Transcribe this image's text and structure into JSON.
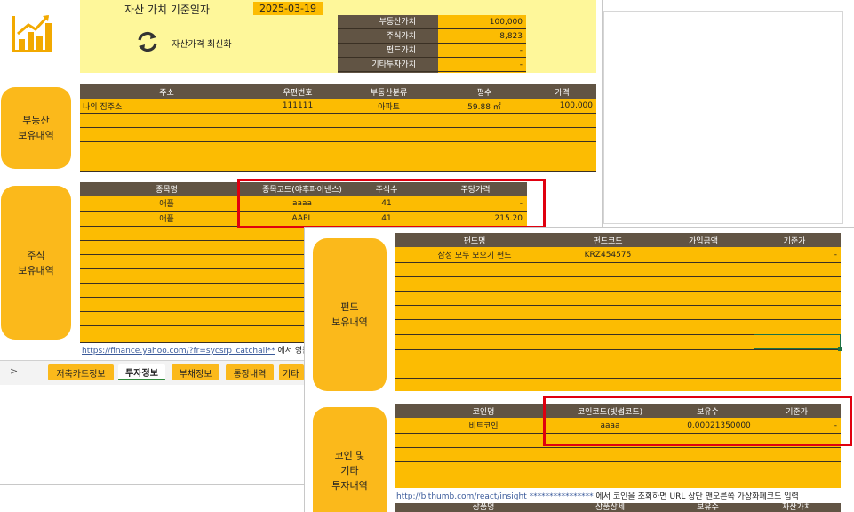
{
  "header": {
    "date_label": "자산 가치 기준일자",
    "date_value": "2025-03-19",
    "refresh_label": "자산가격 최신화",
    "summary": [
      {
        "label": "부동산가치",
        "value": "100,000"
      },
      {
        "label": "주식가치",
        "value": "8,823"
      },
      {
        "label": "펀드가치",
        "value": "-"
      },
      {
        "label": "기타투자가치",
        "value": "-"
      }
    ]
  },
  "real_estate": {
    "section_label": "부동산\n보유내역",
    "columns": [
      "주소",
      "우편번호",
      "부동산분류",
      "평수",
      "가격"
    ],
    "rows": [
      {
        "address": "나의 집주소",
        "zip": "111111",
        "type": "아파트",
        "area": "59.88  ㎡",
        "price": "100,000"
      }
    ]
  },
  "stocks": {
    "section_label": "주식\n보유내역",
    "columns": [
      "종목명",
      "종목코드(야후파이낸스)",
      "주식수",
      "주당가격"
    ],
    "rows": [
      {
        "name": "애플",
        "code": "aaaa",
        "shares": "41",
        "price": "-"
      },
      {
        "name": "애플",
        "code": "AAPL",
        "shares": "41",
        "price": "215.20"
      }
    ],
    "link": "https://finance.yahoo.com/?fr=sycsrp_catchall**",
    "link_note": " 에서 영문으로"
  },
  "sheet_tabs": {
    "arrow": ">",
    "tabs": [
      "저축카드정보",
      "투자정보",
      "부채정보",
      "통장내역",
      "기타"
    ],
    "active": "투자정보"
  },
  "funds": {
    "section_label": "펀드\n보유내역",
    "columns": [
      "펀드명",
      "펀드코드",
      "가입금액",
      "기준가"
    ],
    "rows": [
      {
        "name": "삼성 모두 모으기 펀드",
        "code": "KRZ454575",
        "amount": "",
        "base": "-"
      }
    ]
  },
  "coins": {
    "section_label": "코인 및\n기타\n투자내역",
    "columns": [
      "코인명",
      "코인코드(빗썸코드)",
      "보유수",
      "기준가"
    ],
    "rows": [
      {
        "name": "비트코인",
        "code": "aaaa",
        "qty": "0.00021350000",
        "base": "-"
      }
    ],
    "link": "http://bithumb.com/react/insight ****************",
    "link_note": " 에서 코인을 조회하면 URL 상단 맨오른쪽 가상화폐코드 입력",
    "footer_columns": [
      "상품명",
      "상품상세",
      "보유수",
      "자산가치"
    ]
  },
  "colors": {
    "accent": "#fcbc02",
    "header_dark": "#615444",
    "highlight_red": "#e0000f",
    "panel_yellow": "#fef79a"
  }
}
